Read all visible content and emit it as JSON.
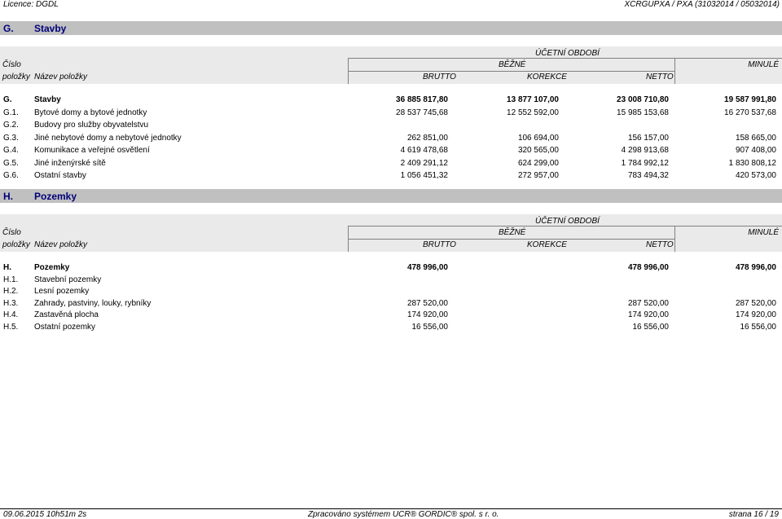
{
  "header": {
    "licence": "Licence: DGDL",
    "doc_code": "XCRGUPXA / PXA  (31032014 / 05032014)"
  },
  "columns": {
    "cislo": "Číslo",
    "polozky": "položky",
    "nazev": "Název položky",
    "ucetni_obdobi": "ÚČETNÍ OBDOBÍ",
    "bezne": "BĚŽNÉ",
    "minule": "MINULÉ",
    "brutto": "BRUTTO",
    "korekce": "KOREKCE",
    "netto": "NETTO"
  },
  "section_g": {
    "code": "G.",
    "name": "Stavby",
    "rows": [
      {
        "code": "G.",
        "name": "Stavby",
        "brutto": "36 885 817,80",
        "korekce": "13 877 107,00",
        "netto": "23 008 710,80",
        "minule": "19 587 991,80",
        "bold": true
      },
      {
        "code": "G.1.",
        "name": "Bytové domy a bytové jednotky",
        "brutto": "28 537 745,68",
        "korekce": "12 552 592,00",
        "netto": "15 985 153,68",
        "minule": "16 270 537,68"
      },
      {
        "code": "G.2.",
        "name": "Budovy pro služby obyvatelstvu",
        "brutto": "",
        "korekce": "",
        "netto": "",
        "minule": ""
      },
      {
        "code": "G.3.",
        "name": "Jiné nebytové domy a nebytové jednotky",
        "brutto": "262 851,00",
        "korekce": "106 694,00",
        "netto": "156 157,00",
        "minule": "158 665,00"
      },
      {
        "code": "G.4.",
        "name": "Komunikace a veřejné osvětlení",
        "brutto": "4 619 478,68",
        "korekce": "320 565,00",
        "netto": "4 298 913,68",
        "minule": "907 408,00"
      },
      {
        "code": "G.5.",
        "name": "Jiné inženýrské sítě",
        "brutto": "2 409 291,12",
        "korekce": "624 299,00",
        "netto": "1 784 992,12",
        "minule": "1 830 808,12"
      },
      {
        "code": "G.6.",
        "name": "Ostatní stavby",
        "brutto": "1 056 451,32",
        "korekce": "272 957,00",
        "netto": "783 494,32",
        "minule": "420 573,00"
      }
    ]
  },
  "section_h": {
    "code": "H.",
    "name": "Pozemky",
    "rows": [
      {
        "code": "H.",
        "name": "Pozemky",
        "brutto": "478 996,00",
        "korekce": "",
        "netto": "478 996,00",
        "minule": "478 996,00",
        "bold": true
      },
      {
        "code": "H.1.",
        "name": "Stavební pozemky",
        "brutto": "",
        "korekce": "",
        "netto": "",
        "minule": ""
      },
      {
        "code": "H.2.",
        "name": "Lesní pozemky",
        "brutto": "",
        "korekce": "",
        "netto": "",
        "minule": ""
      },
      {
        "code": "H.3.",
        "name": "Zahrady, pastviny, louky, rybníky",
        "brutto": "287 520,00",
        "korekce": "",
        "netto": "287 520,00",
        "minule": "287 520,00"
      },
      {
        "code": "H.4.",
        "name": "Zastavěná plocha",
        "brutto": "174 920,00",
        "korekce": "",
        "netto": "174 920,00",
        "minule": "174 920,00"
      },
      {
        "code": "H.5.",
        "name": "Ostatní pozemky",
        "brutto": "16 556,00",
        "korekce": "",
        "netto": "16 556,00",
        "minule": "16 556,00"
      }
    ]
  },
  "footer": {
    "timestamp": "09.06.2015 10h51m 2s",
    "processed": "Zpracováno systémem  UCR® GORDIC® spol. s  r. o.",
    "page": "strana 16 / 19"
  }
}
